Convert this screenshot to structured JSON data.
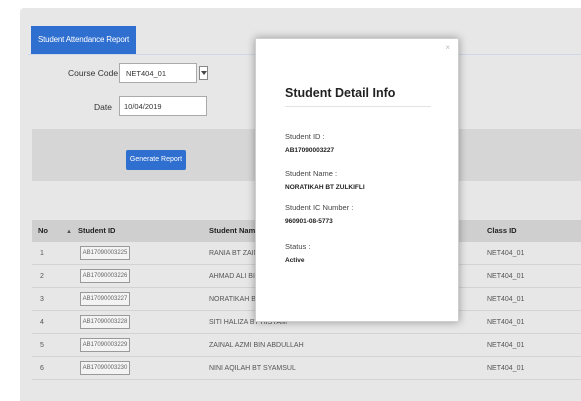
{
  "tab": {
    "label": "Student Attendance Report"
  },
  "form": {
    "course_code_label": "Course Code",
    "course_code_value": "NET404_01",
    "date_label": "Date",
    "date_value": "10/04/2019",
    "generate_label": "Generate Report"
  },
  "table": {
    "headers": {
      "no": "No",
      "student_id": "Student ID",
      "student_name": "Student Name",
      "class_id": "Class ID"
    },
    "rows": [
      {
        "no": "1",
        "student_id": "AB17090003225",
        "student_name": "RANIA BT ZAINAL",
        "class_id": "NET404_01"
      },
      {
        "no": "2",
        "student_id": "AB17090003226",
        "student_name": "AHMAD ALI BIN",
        "class_id": "NET404_01"
      },
      {
        "no": "3",
        "student_id": "AB17090003227",
        "student_name": "NORATIKAH BT Z",
        "class_id": "NET404_01"
      },
      {
        "no": "4",
        "student_id": "AB17090003228",
        "student_name": "SITI HALIZA BT HISYAM",
        "class_id": "NET404_01"
      },
      {
        "no": "5",
        "student_id": "AB17090003229",
        "student_name": "ZAINAL AZMI BIN ABDULLAH",
        "class_id": "NET404_01"
      },
      {
        "no": "6",
        "student_id": "AB17090003230",
        "student_name": "NINI AQILAH BT SYAMSUL",
        "class_id": "NET404_01"
      }
    ]
  },
  "modal": {
    "close": "×",
    "title": "Student Detail Info",
    "student_id_label": "Student ID :",
    "student_id_value": "AB17090003227",
    "student_name_label": "Student Name :",
    "student_name_value": "NORATIKAH BT ZULKIFLI",
    "ic_label": "Student IC Number :",
    "ic_value": "960901-08-5773",
    "status_label": "Status :",
    "status_value": "Active"
  }
}
